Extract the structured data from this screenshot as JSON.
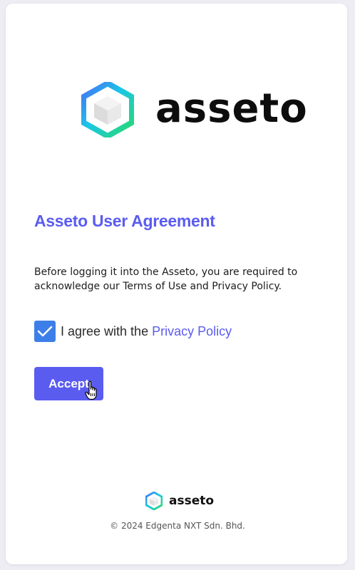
{
  "brand": {
    "name": "asseto",
    "logo_icon": "asseto-hexagon-cube-icon",
    "colors": {
      "gradient_start": "#2bd96b",
      "gradient_mid": "#19c7e6",
      "gradient_end": "#4a6cf7"
    }
  },
  "agreement": {
    "title": "Asseto User Agreement",
    "description": "Before logging it into the Asseto, you are required to acknowledge our Terms of Use and Privacy Policy.",
    "checkbox_checked": true,
    "agree_text": "I agree with the",
    "privacy_link": "Privacy Policy",
    "accept_label": "Accept"
  },
  "footer": {
    "brand": "asseto",
    "copyright": "© 2024 Edgenta NXT Sdn. Bhd."
  },
  "theme": {
    "accent": "#5a5cf0",
    "checkbox": "#3d7fe8"
  }
}
